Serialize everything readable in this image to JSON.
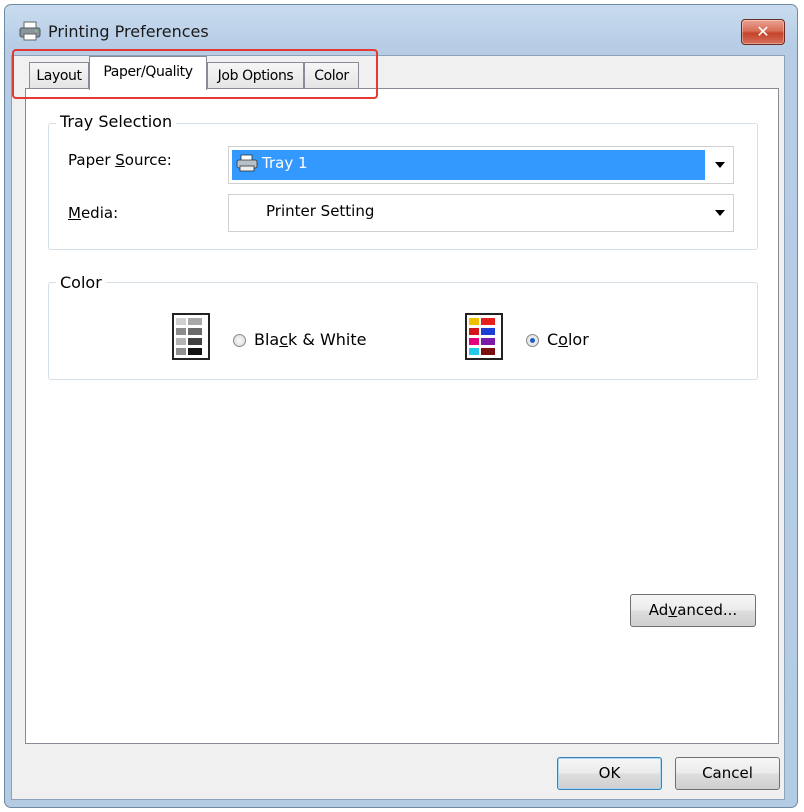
{
  "window": {
    "title": "Printing Preferences"
  },
  "tabs": [
    {
      "label": "Layout",
      "active": false
    },
    {
      "label": "Paper/Quality",
      "active": true
    },
    {
      "label": "Job Options",
      "active": false
    },
    {
      "label": "Color",
      "active": false
    }
  ],
  "tray_selection": {
    "title": "Tray Selection",
    "paper_source": {
      "label_pre": "Paper ",
      "label_key": "S",
      "label_post": "ource:",
      "value": "Tray 1"
    },
    "media": {
      "label_key": "M",
      "label_post": "edia:",
      "value": "Printer Setting"
    }
  },
  "color_group": {
    "title": "Color",
    "bw": {
      "label_pre": "Bla",
      "label_key": "c",
      "label_post": "k & White",
      "checked": false
    },
    "color": {
      "label_pre": "C",
      "label_key": "o",
      "label_post": "lor",
      "checked": true
    }
  },
  "buttons": {
    "advanced": {
      "pre": "Ad",
      "key": "v",
      "post": "anced..."
    },
    "ok": "OK",
    "cancel": "Cancel"
  },
  "icons": [
    "printer-icon",
    "close-icon",
    "tray-printer-icon",
    "grayscale-page-icon",
    "color-page-icon"
  ],
  "colors": {
    "selection": "#3399ff",
    "highlight": "#e53935",
    "close": "#c5432b"
  }
}
